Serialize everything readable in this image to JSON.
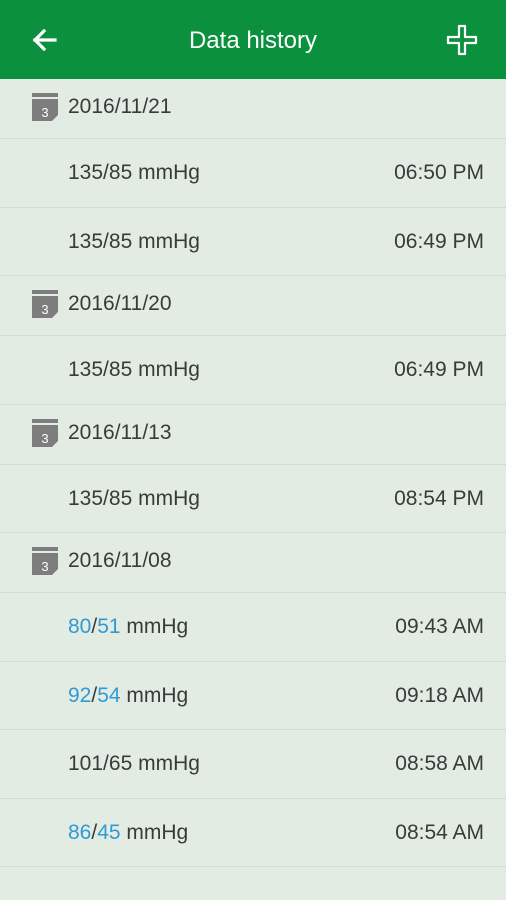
{
  "app_bar": {
    "title": "Data history",
    "back_icon": "arrow-left-icon",
    "add_icon": "plus-icon",
    "color": "#0b913e"
  },
  "calendar_icon": {
    "name": "calendar-icon",
    "number": "3"
  },
  "low_reading_color": "#2f9bd6",
  "groups": [
    {
      "date": "2016/11/21",
      "records": [
        {
          "systolic": "135",
          "diastolic": "85",
          "unit": "mmHg",
          "time": "06:50 PM",
          "low": false
        },
        {
          "systolic": "135",
          "diastolic": "85",
          "unit": "mmHg",
          "time": "06:49 PM",
          "low": false
        }
      ]
    },
    {
      "date": "2016/11/20",
      "records": [
        {
          "systolic": "135",
          "diastolic": "85",
          "unit": "mmHg",
          "time": "06:49 PM",
          "low": false
        }
      ]
    },
    {
      "date": "2016/11/13",
      "records": [
        {
          "systolic": "135",
          "diastolic": "85",
          "unit": "mmHg",
          "time": "08:54 PM",
          "low": false
        }
      ]
    },
    {
      "date": "2016/11/08",
      "records": [
        {
          "systolic": "80",
          "diastolic": "51",
          "unit": "mmHg",
          "time": "09:43 AM",
          "low": true
        },
        {
          "systolic": "92",
          "diastolic": "54",
          "unit": "mmHg",
          "time": "09:18 AM",
          "low": true
        },
        {
          "systolic": "101",
          "diastolic": "65",
          "unit": "mmHg",
          "time": "08:58 AM",
          "low": false
        },
        {
          "systolic": "86",
          "diastolic": "45",
          "unit": "mmHg",
          "time": "08:54 AM",
          "low": true
        }
      ]
    }
  ]
}
